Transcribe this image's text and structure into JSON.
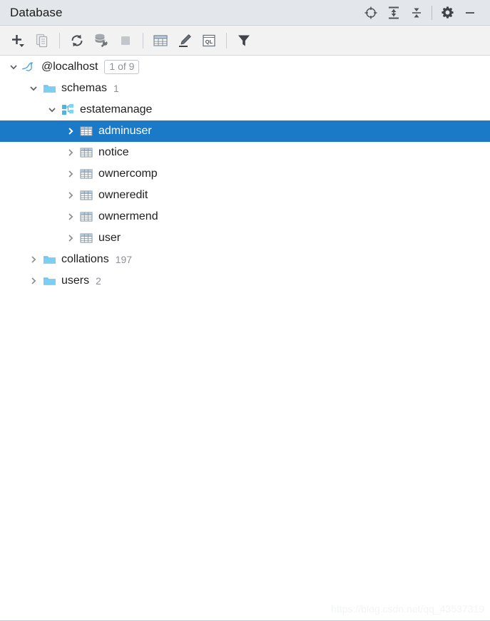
{
  "window": {
    "title": "Database",
    "actions": [
      {
        "name": "locate-in-tree-icon",
        "label": "Select in database tree"
      },
      {
        "name": "expand-all-icon",
        "label": "Expand All"
      },
      {
        "name": "collapse-all-icon",
        "label": "Collapse All"
      },
      {
        "name": "settings-gear-icon",
        "label": "Settings"
      },
      {
        "name": "minimize-icon",
        "label": "Hide"
      }
    ]
  },
  "toolbar": {
    "items": [
      {
        "name": "add-new-button",
        "label": "New",
        "icon": "plus-dropdown-icon",
        "enabled": true
      },
      {
        "name": "duplicate-button",
        "label": "Duplicate",
        "icon": "copy-icon",
        "enabled": false
      },
      {
        "name": "refresh-button",
        "label": "Refresh",
        "icon": "refresh-icon",
        "enabled": true
      },
      {
        "name": "database-tools-button",
        "label": "Database Tools",
        "icon": "database-wrench-icon",
        "enabled": false
      },
      {
        "name": "stop-button",
        "label": "Stop",
        "icon": "stop-square-icon",
        "enabled": false
      },
      {
        "name": "open-table-editor-button",
        "label": "Open Data Editor",
        "icon": "table-grid-icon",
        "enabled": true
      },
      {
        "name": "modify-object-button",
        "label": "Modify Object",
        "icon": "pencil-edit-icon",
        "enabled": true
      },
      {
        "name": "jump-to-query-console-button",
        "label": "Jump to Query Console",
        "icon": "ql-console-icon",
        "enabled": true
      },
      {
        "name": "filter-button",
        "label": "Filter",
        "icon": "filter-funnel-icon",
        "enabled": true
      }
    ]
  },
  "tree": {
    "nodes": [
      {
        "id": "localhost",
        "label": "@localhost",
        "icon": "mysql-dolphin-icon",
        "indent": 0,
        "expanded": true,
        "badge": "1 of 9",
        "count": "",
        "selected": false
      },
      {
        "id": "schemas",
        "label": "schemas",
        "icon": "folder-icon",
        "indent": 1,
        "expanded": true,
        "badge": "",
        "count": "1",
        "selected": false
      },
      {
        "id": "estatemanage",
        "label": "estatemanage",
        "icon": "schema-icon",
        "indent": 2,
        "expanded": true,
        "badge": "",
        "count": "",
        "selected": false
      },
      {
        "id": "adminuser",
        "label": "adminuser",
        "icon": "table-icon",
        "indent": 3,
        "expanded": false,
        "badge": "",
        "count": "",
        "selected": true
      },
      {
        "id": "notice",
        "label": "notice",
        "icon": "table-icon",
        "indent": 3,
        "expanded": false,
        "badge": "",
        "count": "",
        "selected": false
      },
      {
        "id": "ownercomp",
        "label": "ownercomp",
        "icon": "table-icon",
        "indent": 3,
        "expanded": false,
        "badge": "",
        "count": "",
        "selected": false
      },
      {
        "id": "owneredit",
        "label": "owneredit",
        "icon": "table-icon",
        "indent": 3,
        "expanded": false,
        "badge": "",
        "count": "",
        "selected": false
      },
      {
        "id": "ownermend",
        "label": "ownermend",
        "icon": "table-icon",
        "indent": 3,
        "expanded": false,
        "badge": "",
        "count": "",
        "selected": false
      },
      {
        "id": "user",
        "label": "user",
        "icon": "table-icon",
        "indent": 3,
        "expanded": false,
        "badge": "",
        "count": "",
        "selected": false
      },
      {
        "id": "collations",
        "label": "collations",
        "icon": "folder-icon",
        "indent": 1,
        "expanded": false,
        "badge": "",
        "count": "197",
        "selected": false
      },
      {
        "id": "users",
        "label": "users",
        "icon": "folder-icon",
        "indent": 1,
        "expanded": false,
        "badge": "",
        "count": "2",
        "selected": false
      }
    ]
  },
  "watermark": {
    "text": "https://blog.csdn.net/qq_43537319"
  },
  "colors": {
    "selection": "#1a7ac7",
    "titlebar_bg": "#e3e6ea",
    "toolbar_bg": "#f2f2f2",
    "tree_bg": "#ffffff",
    "folder_blue": "#6cc6ef",
    "muted_text": "#8d9196"
  }
}
